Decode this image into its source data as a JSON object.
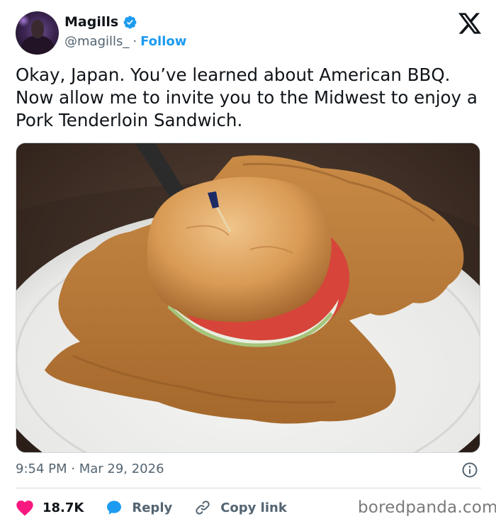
{
  "author": {
    "display_name": "Magills",
    "handle": "@magills_",
    "separator": "·",
    "follow_label": "Follow",
    "verified": true
  },
  "tweet": {
    "text": "Okay, Japan. You’ve learned about American BBQ. Now allow me to invite you to the Midwest to enjoy a Pork Tenderloin Sandwich.",
    "timestamp": "9:54 PM · Mar 29, 2026"
  },
  "actions": {
    "like_count": "18.7K",
    "reply_label": "Reply",
    "copy_link_label": "Copy link"
  },
  "watermark": "boredpanda.com",
  "icons": {
    "verified": "verified-badge-icon",
    "x_logo": "x-logo-icon",
    "info": "info-icon",
    "like": "heart-icon",
    "reply": "speech-bubble-icon",
    "copy_link": "link-icon"
  },
  "colors": {
    "accent": "#1d9bf0",
    "like": "#f91880",
    "text": "#0f1419",
    "secondary_text": "#536471",
    "border": "#cfd9de"
  }
}
